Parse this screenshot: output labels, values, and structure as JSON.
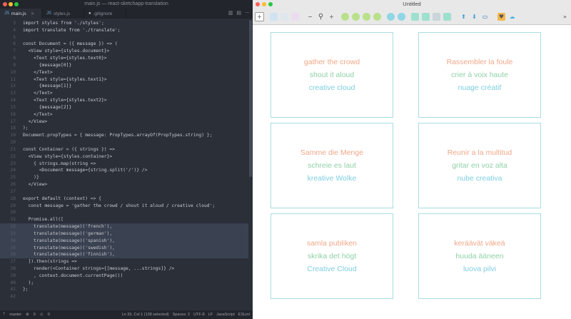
{
  "editor": {
    "window_title": "main.js — react-sketchapp-translation",
    "tabs": [
      {
        "label": "main.js",
        "icon": "js-file-icon"
      },
      {
        "label": "styles.js",
        "icon": "js-file-icon"
      },
      {
        "label": ".gitignore",
        "icon": "github-icon"
      }
    ],
    "code_lines": [
      {
        "n": "3",
        "t": "import styles from './styles';"
      },
      {
        "n": "4",
        "t": "import translate from './translate';"
      },
      {
        "n": "5",
        "t": ""
      },
      {
        "n": "6",
        "t": "const Document = ({ message }) => ("
      },
      {
        "n": "7",
        "t": "  <View style={styles.document}>"
      },
      {
        "n": "8",
        "t": "    <Text style={styles.text0}>"
      },
      {
        "n": "9",
        "t": "      {message[0]}"
      },
      {
        "n": "10",
        "t": "    </Text>"
      },
      {
        "n": "11",
        "t": "    <Text style={styles.text1}>"
      },
      {
        "n": "12",
        "t": "      {message[1]}"
      },
      {
        "n": "13",
        "t": "    </Text>"
      },
      {
        "n": "14",
        "t": "    <Text style={styles.text2}>"
      },
      {
        "n": "15",
        "t": "      {message[2]}"
      },
      {
        "n": "16",
        "t": "    </Text>"
      },
      {
        "n": "17",
        "t": "  </View>"
      },
      {
        "n": "18",
        "t": ");"
      },
      {
        "n": "19",
        "t": "Document.propTypes = { message: PropTypes.arrayOf(PropTypes.string) };"
      },
      {
        "n": "20",
        "t": ""
      },
      {
        "n": "21",
        "t": "const Container = ({ strings }) =>"
      },
      {
        "n": "22",
        "t": "  <View style={styles.container}>"
      },
      {
        "n": "23",
        "t": "    { strings.map(string =>"
      },
      {
        "n": "24",
        "t": "      <Document message={string.split('/')} />"
      },
      {
        "n": "25",
        "t": "    )}"
      },
      {
        "n": "26",
        "t": "  </View>"
      },
      {
        "n": "27",
        "t": ""
      },
      {
        "n": "28",
        "t": "export default (context) => {"
      },
      {
        "n": "29",
        "t": "  const message = 'gather the crowd / shout it aloud / creative cloud';"
      },
      {
        "n": "30",
        "t": ""
      },
      {
        "n": "31",
        "t": "  Promise.all(["
      },
      {
        "n": "32",
        "t": "    translate(message)('french'),"
      },
      {
        "n": "33",
        "t": "    translate(message)('german'),"
      },
      {
        "n": "34",
        "t": "    translate(message)('spanish'),"
      },
      {
        "n": "35",
        "t": "    translate(message)('swedish'),"
      },
      {
        "n": "36",
        "t": "    translate(message)('finnish'),"
      },
      {
        "n": "37",
        "t": "  ]).then(strings =>"
      },
      {
        "n": "38",
        "t": "    render(<Container strings={[message, ...strings]} />"
      },
      {
        "n": "39",
        "t": "    , context.document.currentPage())"
      },
      {
        "n": "40",
        "t": "  );"
      },
      {
        "n": "41",
        "t": "};"
      },
      {
        "n": "42",
        "t": ""
      }
    ],
    "status": {
      "branch": "master",
      "errors": "0",
      "warnings": "0",
      "position": "Ln 33, Col 1 (138 selected)",
      "indent": "Spaces: 2",
      "encoding": "UTF-8",
      "eol": "LF",
      "language": "JavaScript",
      "linter": "ESLint"
    }
  },
  "sketch": {
    "window_title": "Untitled",
    "artboards": [
      [
        "gather the crowd",
        "shout it aloud",
        "creative cloud"
      ],
      [
        "Rassembler la foule",
        "crier à voix haute",
        "nuage créatif"
      ],
      [
        "Samme die Menge",
        "schreie es laut",
        "kreative Wolke"
      ],
      [
        "Reunir a la multitud",
        "gritar en voz alta",
        "nube creativa"
      ],
      [
        "samla publiken",
        "skrika det högt",
        "Creative Cloud"
      ],
      [
        "keräävät väkeä",
        "huuda ääneen",
        "luova pilvi"
      ]
    ],
    "colors": {
      "line0": "#f0a889",
      "line1": "#8fd1a6",
      "line2": "#7fcfe0",
      "border": "#a8dde0"
    }
  }
}
